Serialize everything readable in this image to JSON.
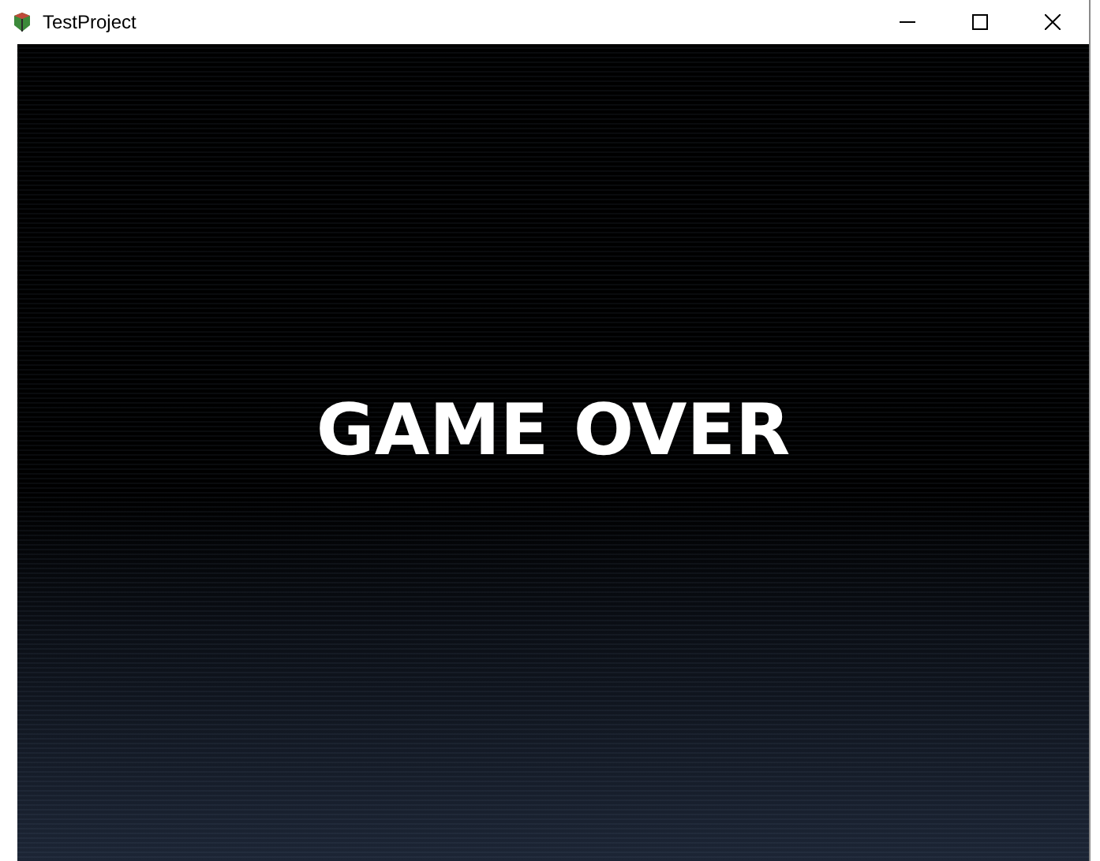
{
  "window": {
    "title": "TestProject"
  },
  "screen": {
    "message": "GAME OVER"
  }
}
